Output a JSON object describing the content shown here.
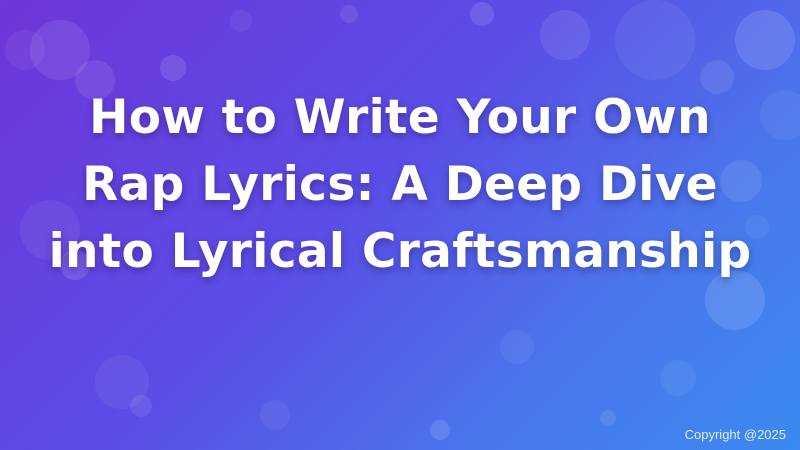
{
  "banner": {
    "title": "How to Write Your Own Rap Lyrics: A Deep Dive into Lyrical Craftsmanship",
    "copyright": "Copyright @2025"
  },
  "colors": {
    "gradient_start": "#6f35d9",
    "gradient_mid": "#5a4ee6",
    "gradient_end": "#3a8af0",
    "text": "#ffffff"
  }
}
